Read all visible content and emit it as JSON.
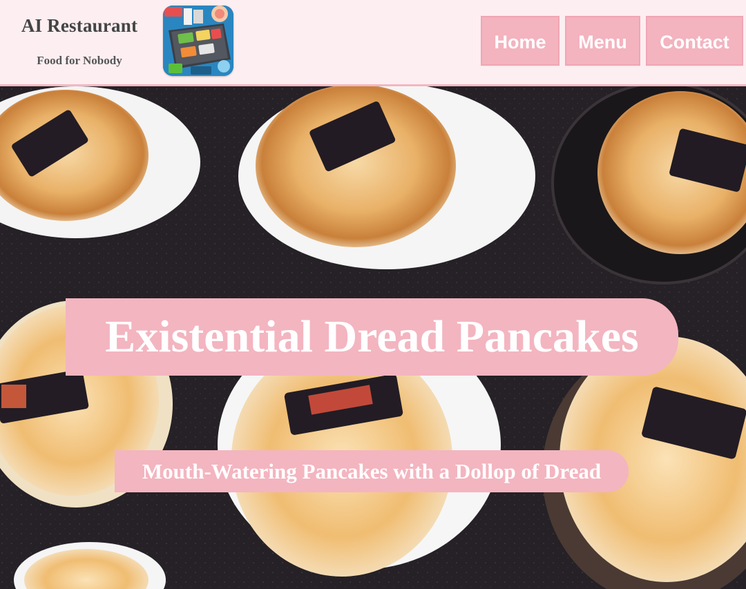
{
  "header": {
    "title": "AI Restaurant",
    "tagline": "Food for Nobody",
    "logo_icon": "restaurant-kitchen-grill-icon"
  },
  "nav": {
    "items": [
      {
        "label": "Home"
      },
      {
        "label": "Menu"
      },
      {
        "label": "Contact"
      }
    ]
  },
  "hero": {
    "background_image": "pancakes-with-dark-squares-photo",
    "title": "Existential Dread Pancakes",
    "subtitle": "Mouth-Watering Pancakes with a Dollop of Dread"
  },
  "colors": {
    "page_background": "#fdeef1",
    "accent_pink": "#f3b5c0",
    "header_border": "#f3b7c1",
    "title_text": "#444444",
    "button_text": "#ffffff"
  }
}
